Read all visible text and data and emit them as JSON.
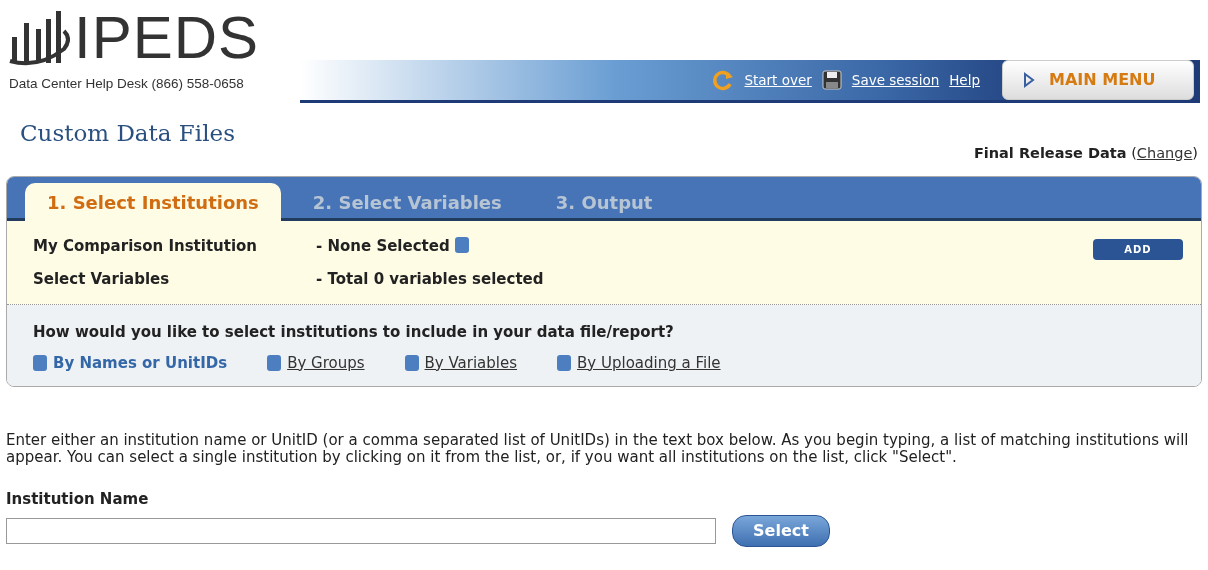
{
  "header": {
    "logo_text": "IPEDS",
    "helpdesk": "Data Center Help Desk (866) 558-0658",
    "links": [
      {
        "kind": "restart",
        "label": "Start over"
      },
      {
        "kind": "save",
        "label": "Save session"
      },
      {
        "kind": "plain",
        "label": "Help"
      }
    ],
    "main_menu": "MAIN MENU"
  },
  "page_title": "Custom Data Files",
  "release": {
    "label": "Final Release Data",
    "open": "(",
    "link": "Change",
    "close": ")"
  },
  "tabs": [
    {
      "label": "1. Select Institutions",
      "selected": true
    },
    {
      "label": "2. Select Variables",
      "selected": false
    },
    {
      "label": "3. Output",
      "selected": false
    }
  ],
  "summary": [
    {
      "label": "My Comparison Institution",
      "value": "- None Selected",
      "info": true
    },
    {
      "label": "Select Variables",
      "value": "- Total 0 variables selected",
      "info": false
    }
  ],
  "add_button": "ADD",
  "question": "How would you like to select institutions to include in your data file/report?",
  "methods": [
    {
      "label": "By Names or UnitIDs",
      "selected": true
    },
    {
      "label": "By Groups",
      "selected": false
    },
    {
      "label": "By Variables",
      "selected": false
    },
    {
      "label": "By Uploading a File",
      "selected": false
    }
  ],
  "instructions": "Enter either an institution name or UnitID (or a comma separated list of UnitIDs) in the text box below. As you begin typing, a list of matching institutions will appear. You can select a single institution by clicking on it from the list, or, if you want all institutions on the list, click \"Select\".",
  "field_label": "Institution Name",
  "select_button": "Select"
}
